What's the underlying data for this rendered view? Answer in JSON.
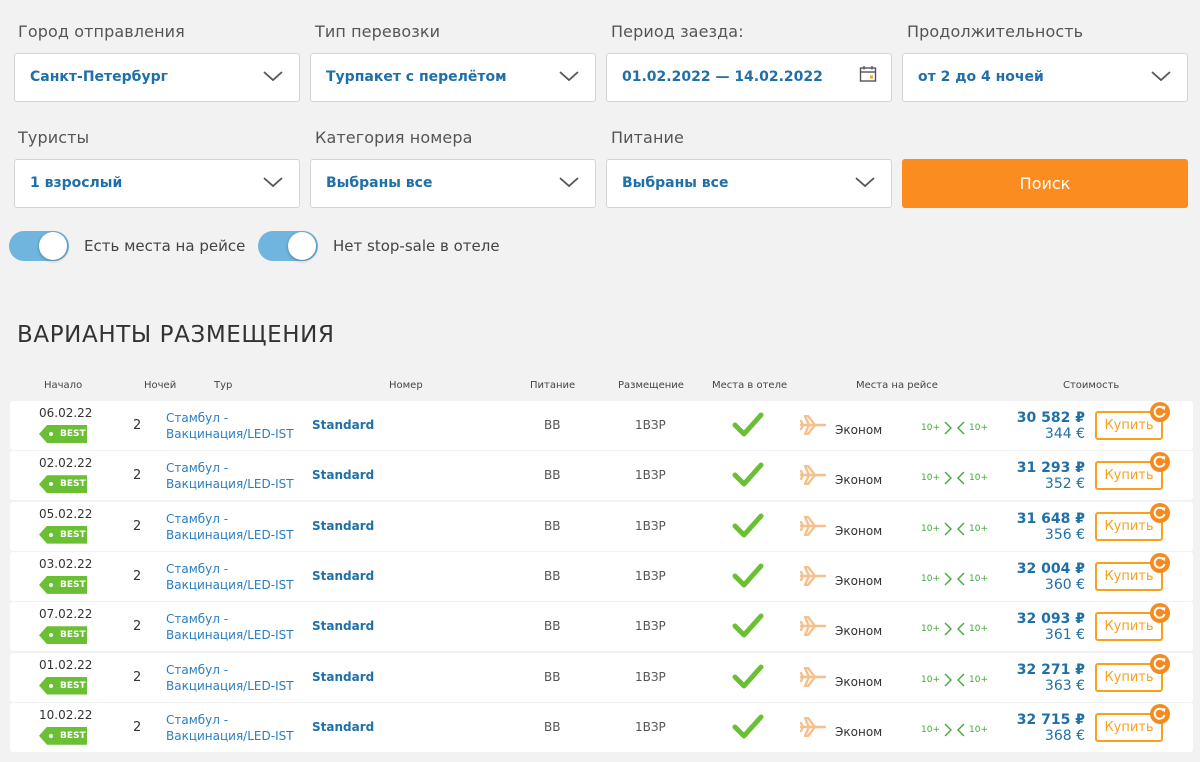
{
  "filters": {
    "departure": {
      "label": "Город отправления",
      "value": "Санкт-Петербург"
    },
    "transport": {
      "label": "Тип перевозки",
      "value": "Турпакет с перелётом"
    },
    "period": {
      "label": "Период заезда:",
      "value": "01.02.2022 — 14.02.2022"
    },
    "duration": {
      "label": "Продолжительность",
      "value": "от 2 до 4 ночей"
    },
    "tourists": {
      "label": "Туристы",
      "value": "1 взрослый"
    },
    "room_category": {
      "label": "Категория номера",
      "value": "Выбраны все"
    },
    "meal": {
      "label": "Питание",
      "value": "Выбраны все"
    },
    "search_button": "Поиск",
    "toggle_seats": {
      "label": "Есть места на рейсе",
      "on": true
    },
    "toggle_stopsale": {
      "label": "Нет stop-sale в отеле",
      "on": true
    }
  },
  "section_title": "ВАРИАНТЫ РАЗМЕЩЕНИЯ",
  "columns": {
    "start": "Начало",
    "nights": "Ночей",
    "tour": "Тур",
    "room": "Номер",
    "meal": "Питание",
    "placement": "Размещение",
    "hotel_seats": "Места в отеле",
    "flight_seats": "Места на рейсе",
    "price": "Стоимость"
  },
  "colors": {
    "accent": "#fb8c1f",
    "link": "#1f6fa8",
    "best": "#6bbf35",
    "toggle": "#6fb5de"
  },
  "rows": [
    {
      "date": "06.02.22",
      "badge": "BEST",
      "nights": "2",
      "tour": "Стамбул - Вакцинация/LED-IST",
      "room": "Standard",
      "meal": "BB",
      "placement": "1ВЗР",
      "flight_class": "Эконом",
      "seats_out": "10+",
      "seats_back": "10+",
      "price_rub": "30 582 ₽",
      "price_eur": "344 €",
      "buy": "Купить"
    },
    {
      "date": "02.02.22",
      "badge": "BEST",
      "nights": "2",
      "tour": "Стамбул - Вакцинация/LED-IST",
      "room": "Standard",
      "meal": "BB",
      "placement": "1ВЗР",
      "flight_class": "Эконом",
      "seats_out": "10+",
      "seats_back": "10+",
      "price_rub": "31 293 ₽",
      "price_eur": "352 €",
      "buy": "Купить"
    },
    {
      "date": "05.02.22",
      "badge": "BEST",
      "nights": "2",
      "tour": "Стамбул - Вакцинация/LED-IST",
      "room": "Standard",
      "meal": "BB",
      "placement": "1ВЗР",
      "flight_class": "Эконом",
      "seats_out": "10+",
      "seats_back": "10+",
      "price_rub": "31 648 ₽",
      "price_eur": "356 €",
      "buy": "Купить"
    },
    {
      "date": "03.02.22",
      "badge": "BEST",
      "nights": "2",
      "tour": "Стамбул - Вакцинация/LED-IST",
      "room": "Standard",
      "meal": "BB",
      "placement": "1ВЗР",
      "flight_class": "Эконом",
      "seats_out": "10+",
      "seats_back": "10+",
      "price_rub": "32 004 ₽",
      "price_eur": "360 €",
      "buy": "Купить"
    },
    {
      "date": "07.02.22",
      "badge": "BEST",
      "nights": "2",
      "tour": "Стамбул - Вакцинация/LED-IST",
      "room": "Standard",
      "meal": "BB",
      "placement": "1ВЗР",
      "flight_class": "Эконом",
      "seats_out": "10+",
      "seats_back": "10+",
      "price_rub": "32 093 ₽",
      "price_eur": "361 €",
      "buy": "Купить"
    },
    {
      "date": "01.02.22",
      "badge": "BEST",
      "nights": "2",
      "tour": "Стамбул - Вакцинация/LED-IST",
      "room": "Standard",
      "meal": "BB",
      "placement": "1ВЗР",
      "flight_class": "Эконом",
      "seats_out": "10+",
      "seats_back": "10+",
      "price_rub": "32 271 ₽",
      "price_eur": "363 €",
      "buy": "Купить"
    },
    {
      "date": "10.02.22",
      "badge": "BEST",
      "nights": "2",
      "tour": "Стамбул - Вакцинация/LED-IST",
      "room": "Standard",
      "meal": "BB",
      "placement": "1ВЗР",
      "flight_class": "Эконом",
      "seats_out": "10+",
      "seats_back": "10+",
      "price_rub": "32 715 ₽",
      "price_eur": "368 €",
      "buy": "Купить"
    }
  ]
}
